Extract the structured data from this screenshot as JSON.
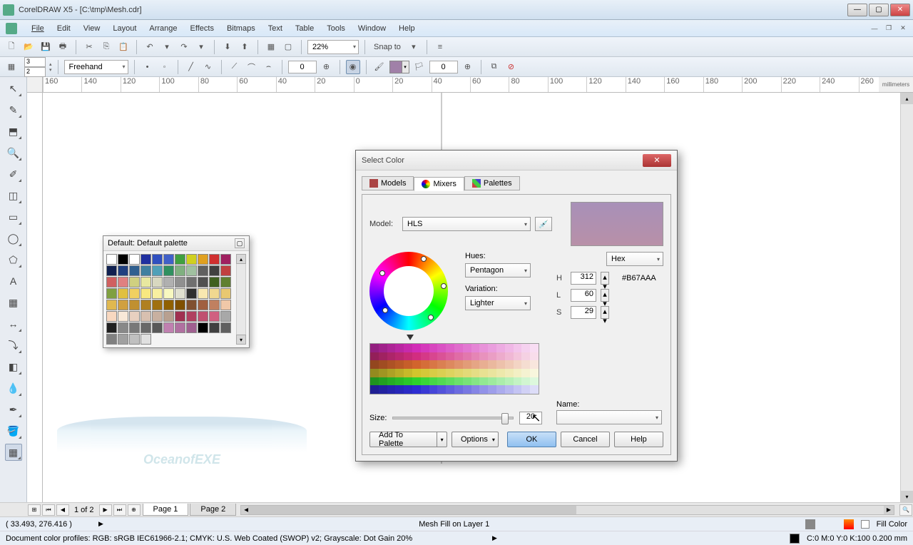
{
  "app": {
    "title": "CorelDRAW X5 - [C:\\tmp\\Mesh.cdr]"
  },
  "menu": {
    "items": [
      "File",
      "Edit",
      "View",
      "Layout",
      "Arrange",
      "Effects",
      "Bitmaps",
      "Text",
      "Table",
      "Tools",
      "Window",
      "Help"
    ]
  },
  "toolbar1": {
    "zoom": "22%",
    "snap": "Snap to"
  },
  "toolbar2": {
    "rows": "3",
    "cols": "2",
    "tool": "Freehand",
    "val1": "0",
    "val2": "0",
    "swatch": "#a080a8"
  },
  "ruler": {
    "unit": "millimeters",
    "ticks_h": [
      "160",
      "140",
      "120",
      "100",
      "80",
      "60",
      "40",
      "20",
      "0",
      "20",
      "40",
      "60",
      "80",
      "100",
      "120",
      "140",
      "160",
      "180",
      "200",
      "220",
      "240",
      "260"
    ]
  },
  "palette_panel": {
    "title": "Default: Default palette",
    "colors": [
      "#ffffff",
      "#000000",
      "#ffffff",
      "#2030a0",
      "#3050c0",
      "#4060c8",
      "#40a040",
      "#d0d020",
      "#e0a020",
      "#d03030",
      "#a02060",
      "#102050",
      "#204080",
      "#306090",
      "#4080a0",
      "#50a0b8",
      "#309060",
      "#80b080",
      "#a0c0a0",
      "#606060",
      "#404040",
      "#c04040",
      "#d06060",
      "#e08080",
      "#d0d080",
      "#e8e8a0",
      "#d8d8c0",
      "#b0b0b0",
      "#909090",
      "#707070",
      "#505050",
      "#406020",
      "#608030",
      "#80a040",
      "#e0c040",
      "#f0d060",
      "#f8e880",
      "#f8f0a0",
      "#f8f8c0",
      "#e0e0d0",
      "#303030",
      "#f8e8b0",
      "#f0d890",
      "#e8c870",
      "#e0b850",
      "#d0a040",
      "#c09030",
      "#b08020",
      "#a07010",
      "#906000",
      "#805000",
      "#805030",
      "#a06040",
      "#c08060",
      "#f0c8a8",
      "#f8d8c0",
      "#f8e8d8",
      "#e8d0c0",
      "#d8c0b0",
      "#c8b0a0",
      "#b8a090",
      "#a03050",
      "#b04060",
      "#c05070",
      "#d06080",
      "#a8a8a8",
      "#202020",
      "#888888",
      "#787878",
      "#686868",
      "#585858",
      "#c080b0",
      "#b070a0",
      "#a06090",
      "#000000",
      "#404040",
      "#606060",
      "#808080",
      "#a0a0a0",
      "#c0c0c0",
      "#e0e0e0"
    ]
  },
  "dialog": {
    "title": "Select Color",
    "tabs": {
      "models": "Models",
      "mixers": "Mixers",
      "palettes": "Palettes",
      "active": "Mixers"
    },
    "model_label": "Model:",
    "model_value": "HLS",
    "hues_label": "Hues:",
    "hues_value": "Pentagon",
    "variation_label": "Variation:",
    "variation_value": "Lighter",
    "hex_label": "Hex",
    "hex_value": "#B67AAA",
    "h_label": "H",
    "h_value": "312",
    "l_label": "L",
    "l_value": "60",
    "s_label": "S",
    "s_value": "29",
    "name_label": "Name:",
    "name_value": "",
    "size_label": "Size:",
    "size_value": "20",
    "buttons": {
      "add_palette": "Add To Palette",
      "options": "Options",
      "ok": "OK",
      "cancel": "Cancel",
      "help": "Help"
    },
    "preview_color": "#B67AAA"
  },
  "page_nav": {
    "counter": "1 of 2",
    "page1": "Page 1",
    "page2": "Page 2"
  },
  "status": {
    "coords": "( 33.493, 276.416 )",
    "mid": "Mesh Fill on Layer 1",
    "fill_label": "Fill Color",
    "profile": "Document color profiles: RGB: sRGB IEC61966-2.1; CMYK: U.S. Web Coated (SWOP) v2; Grayscale: Dot Gain 20%",
    "outline": "C:0 M:0 Y:0 K:100  0.200 mm"
  },
  "watermark": {
    "text": "OceanofEXE"
  }
}
